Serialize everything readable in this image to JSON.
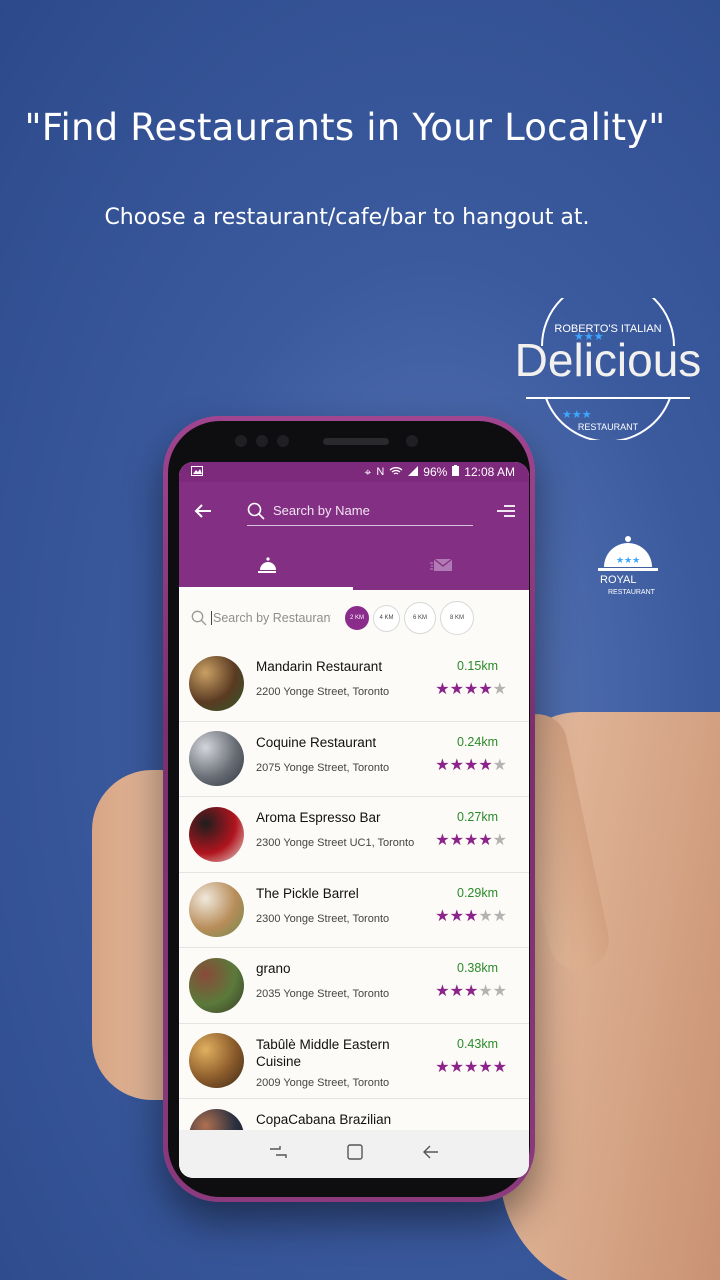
{
  "promo": {
    "headline": "\"Find Restaurants in Your Locality\"",
    "subline": "Choose a restaurant/cafe/bar to hangout at."
  },
  "logos": {
    "delicious": {
      "top": "ROBERTO'S ITALIAN",
      "main": "Delicious",
      "bottom": "RESTAURANT"
    },
    "royal": {
      "main": "ROYAL",
      "bottom": "RESTAURANT"
    }
  },
  "status_bar": {
    "battery": "96%",
    "time": "12:08 AM"
  },
  "app_bar": {
    "search_placeholder": "Search by Name"
  },
  "tabs": [
    {
      "icon": "cloche-icon",
      "active": true
    },
    {
      "icon": "mail-icon",
      "active": false
    }
  ],
  "filter": {
    "search_placeholder": "Search by Restaurant",
    "distances": [
      "2 KM",
      "4 KM",
      "6 KM",
      "8 KM"
    ],
    "selected": "2 KM"
  },
  "restaurants": [
    {
      "name": "Mandarin Restaurant",
      "address": "2200 Yonge Street, Toronto",
      "distance": "0.15km",
      "rating": 4,
      "thumb_colors": [
        "#5a3a22",
        "#c9a064",
        "#2f5a2a"
      ]
    },
    {
      "name": "Coquine Restaurant",
      "address": "2075 Yonge Street, Toronto",
      "distance": "0.24km",
      "rating": 4,
      "thumb_colors": [
        "#6a6e76",
        "#d3d6da",
        "#2e3440"
      ]
    },
    {
      "name": "Aroma Espresso Bar",
      "address": "2300 Yonge Street UC1, Toronto",
      "distance": "0.27km",
      "rating": 3.5,
      "thumb_colors": [
        "#b0141e",
        "#1e1e1e",
        "#e8e0d8"
      ]
    },
    {
      "name": "The Pickle Barrel",
      "address": "2300 Yonge Street, Toronto",
      "distance": "0.29km",
      "rating": 3,
      "thumb_colors": [
        "#b88d5a",
        "#f0e8dc",
        "#6f8a4c"
      ]
    },
    {
      "name": "grano",
      "address": "2035 Yonge Street, Toronto",
      "distance": "0.38km",
      "rating": 2.5,
      "thumb_colors": [
        "#5a7a3a",
        "#8a4a3a",
        "#3a3a2a"
      ]
    },
    {
      "name": "Tabûlè Middle Eastern Cuisine",
      "address": "2009 Yonge Street, Toronto",
      "distance": "0.43km",
      "rating": 4.5,
      "thumb_colors": [
        "#8a5a2a",
        "#e0b060",
        "#3a2a1a"
      ]
    },
    {
      "name": "CopaCabana Brazilian",
      "address": "",
      "distance": "",
      "rating": 0,
      "thumb_colors": [
        "#2a3040",
        "#b07050",
        "#1a1a1a"
      ]
    }
  ],
  "colors": {
    "accent": "#832f84",
    "distance": "#2a8a2a",
    "star_on": "#8c238b",
    "star_off": "#b3b3b3"
  }
}
